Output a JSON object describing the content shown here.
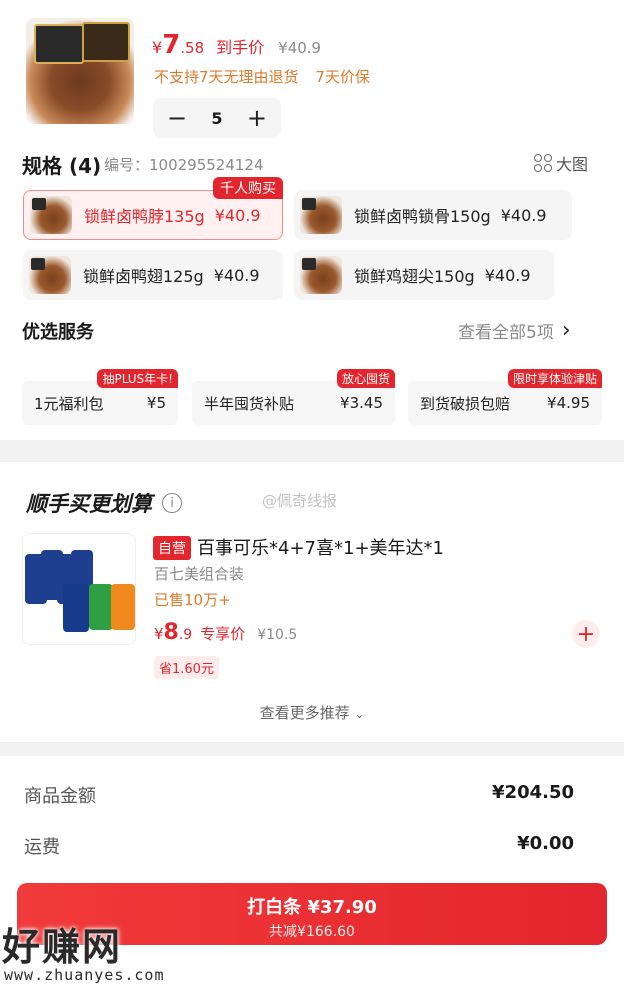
{
  "product": {
    "price_symbol": "¥",
    "price_int": "7",
    "price_dec": ".58",
    "price_tag": "到手价",
    "original_price": "¥40.9",
    "policy_1": "不支持7天无理由退货",
    "policy_2": "7天价保",
    "quantity": "5",
    "minus": "−",
    "plus": "+"
  },
  "spec": {
    "title": "规格 (4)",
    "code_label": "编号：100295524124",
    "big_image": "大图",
    "hot_badge": "千人购买",
    "items": [
      {
        "name": "锁鲜卤鸭脖135g",
        "price": "¥40.9"
      },
      {
        "name": "锁鲜卤鸭锁骨150g",
        "price": "¥40.9"
      },
      {
        "name": "锁鲜卤鸭翅125g",
        "price": "¥40.9"
      },
      {
        "name": "锁鲜鸡翅尖150g",
        "price": "¥40.9"
      }
    ]
  },
  "service": {
    "title": "优选服务",
    "view_all": "查看全部5项",
    "items": [
      {
        "name": "1元福利包",
        "price": "¥5",
        "tag": "抽PLUS年卡!"
      },
      {
        "name": "半年囤货补贴",
        "price": "¥3.45",
        "tag": "放心囤货"
      },
      {
        "name": "到货破损包赔",
        "price": "¥4.95",
        "tag": "限时享体验津贴"
      }
    ]
  },
  "combo": {
    "title": "顺手买更划算",
    "watermark": "@佩奇线报",
    "self_tag": "自营",
    "name": "百事可乐*4+7喜*1+美年达*1",
    "sub": "百七美组合装",
    "sold": "已售10万+",
    "price_symbol": "¥",
    "price_int": "8",
    "price_dec": ".9",
    "price_tag": "专享价",
    "original_price": "¥10.5",
    "save": "省1.60元",
    "more": "查看更多推荐",
    "add": "+"
  },
  "summary": {
    "goods_label": "商品金额",
    "goods_value": "¥204.50",
    "shipping_label": "运费",
    "shipping_value": "¥0.00"
  },
  "pay": {
    "label": "打白条 ¥37.90",
    "discount": "共减¥166.60"
  },
  "watermark_logo": {
    "text": "好赚网",
    "url": "www.zhuanyes.com"
  },
  "colors": {
    "accent": "#e3262d",
    "orange": "#e07a2a"
  }
}
